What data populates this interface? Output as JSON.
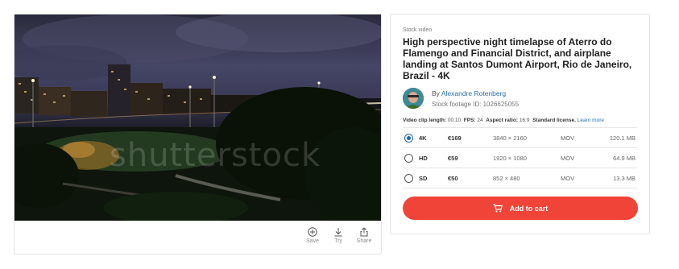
{
  "preview": {
    "watermark": "shutterstock"
  },
  "actions": [
    {
      "label": "Save",
      "icon": "plus-circle-icon"
    },
    {
      "label": "Try",
      "icon": "download-icon"
    },
    {
      "label": "Share",
      "icon": "share-icon"
    }
  ],
  "info": {
    "eyebrow": "Stock video",
    "title": "High perspective night timelapse of Aterro do Flamengo and Financial District, and airplane landing at Santos Dumont Airport, Rio de Janeiro, Brazil - 4K",
    "by_prefix": "By",
    "author": "Alexandre Rotenberg",
    "footage_id": "Stock footage ID: 1026625055",
    "meta": {
      "clip_length_label": "Video clip length:",
      "clip_length": "00:10",
      "fps_label": "FPS:",
      "fps": "24",
      "aspect_label": "Aspect ratio:",
      "aspect": "16:9",
      "license_label": "Standard license.",
      "learn_more": "Learn more"
    },
    "options": [
      {
        "res": "4K",
        "price": "€169",
        "dim": "3840 × 2160",
        "fmt": "MOV",
        "size": "120.1 MB",
        "selected": true
      },
      {
        "res": "HD",
        "price": "€59",
        "dim": "1920 × 1080",
        "fmt": "MOV",
        "size": "64.9 MB",
        "selected": false
      },
      {
        "res": "SD",
        "price": "€50",
        "dim": "852 × 480",
        "fmt": "MOV",
        "size": "13.3 MB",
        "selected": false
      }
    ],
    "cart_label": "Add to cart"
  },
  "colors": {
    "accent": "#f04438",
    "link": "#2a6fb0",
    "radio_selected": "#1c63b8"
  }
}
